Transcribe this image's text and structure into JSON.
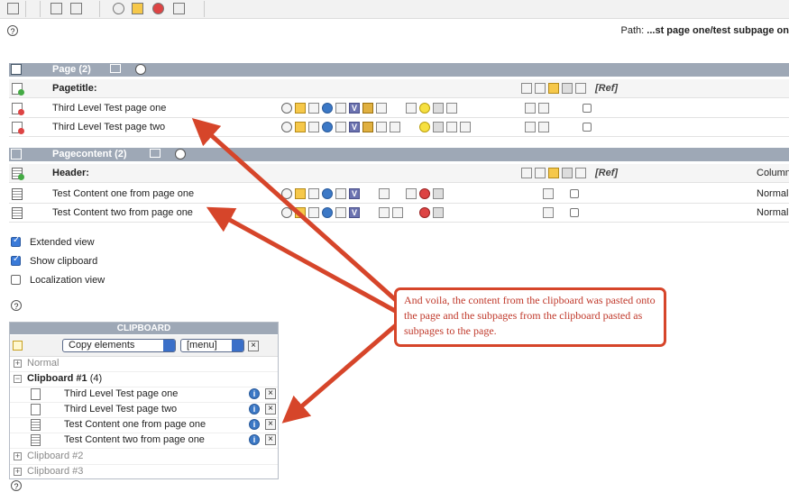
{
  "path": {
    "label": "Path:",
    "value": "...st page one/test subpage on"
  },
  "page_section": {
    "title": "Page (2)",
    "header": {
      "title": "Pagetitle:",
      "ref": "[Ref]"
    },
    "rows": [
      {
        "title": "Third Level Test page one"
      },
      {
        "title": "Third Level Test page two"
      }
    ]
  },
  "content_section": {
    "title": "Pagecontent (2)",
    "header": {
      "title": "Header:",
      "ref": "[Ref]",
      "column": "Column"
    },
    "rows": [
      {
        "title": "Test Content one from page one",
        "column": "Normal"
      },
      {
        "title": "Test Content two from page one",
        "column": "Normal"
      }
    ]
  },
  "options": [
    {
      "label": "Extended view",
      "checked": true
    },
    {
      "label": "Show clipboard",
      "checked": true
    },
    {
      "label": "Localization view",
      "checked": false
    }
  ],
  "clipboard": {
    "title": "CLIPBOARD",
    "mode": "Copy elements",
    "menu": "[menu]",
    "normal": "Normal",
    "active": {
      "title": "Clipboard #1",
      "count": "(4)"
    },
    "items": [
      {
        "title": "Third Level Test page one",
        "type": "page"
      },
      {
        "title": "Third Level Test page two",
        "type": "page"
      },
      {
        "title": "Test Content one from page one",
        "type": "content"
      },
      {
        "title": "Test Content two from page one",
        "type": "content"
      }
    ],
    "others": [
      "Clipboard #2",
      "Clipboard #3"
    ]
  },
  "callout": {
    "text": "And voila, the content from the clipboard was pasted onto the page and the subpages from the clipboard pasted as subpages to the page.",
    "color": "#d6452a"
  },
  "icons": {
    "help": "?",
    "info": "i",
    "close": "×",
    "expand": "+",
    "collapse": "−",
    "version": "V"
  }
}
